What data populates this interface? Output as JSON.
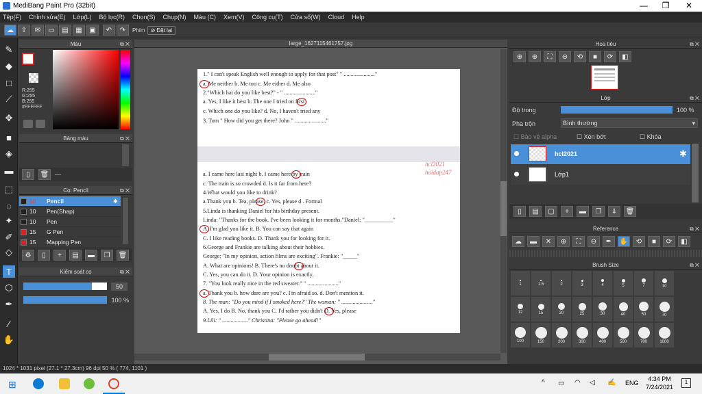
{
  "window": {
    "title": "MediBang Paint Pro (32bit)",
    "minimize": "—",
    "maximize": "❐",
    "close": "✕"
  },
  "menu": [
    "Tệp(F)",
    "Chỉnh sửa(E)",
    "Lớp(L)",
    "Bộ lọc(R)",
    "Chọn(S)",
    "Chụp(N)",
    "Màu (C)",
    "Xem(V)",
    "Công cụ(T)",
    "Cửa sổ(W)",
    "Cloud",
    "Help"
  ],
  "toolbar": {
    "phim_label": "Phím",
    "reset_label": "Đặt lại"
  },
  "canvas": {
    "tab_title": "large_1627115461757.jpg"
  },
  "color_panel": {
    "title": "Màu",
    "r": "R:255",
    "g": "G:255",
    "b": "B:255",
    "hex": "#FFFFFF"
  },
  "palette_panel": {
    "title": "Bảng màu",
    "dash": "---"
  },
  "brush_panel": {
    "title": "Cọ: Pencil",
    "items": [
      {
        "size": "50",
        "name": "Pencil",
        "color": "#222222",
        "selected": true
      },
      {
        "size": "10",
        "name": "Pen(Shap)",
        "color": "#222222",
        "selected": false
      },
      {
        "size": "10",
        "name": "Pen",
        "color": "#222222",
        "selected": false
      },
      {
        "size": "15",
        "name": "G Pen",
        "color": "#e02020",
        "selected": false
      },
      {
        "size": "15",
        "name": "Mapping Pen",
        "color": "#e02020",
        "selected": false
      }
    ]
  },
  "brush_control": {
    "title": "Kiểm soát cọ",
    "size": "50",
    "opacity": "100 %",
    "size_fraction": 0.82,
    "opacity_fraction": 1.0
  },
  "navigator": {
    "title": "Hoa tiêu"
  },
  "layer_panel": {
    "title": "Lớp",
    "opacity_label": "Độ trong",
    "opacity_value": "100 %",
    "blend_label": "Pha trộn",
    "blend_value": "Bình thường",
    "protect_alpha": "Bảo vệ alpha",
    "clipping": "Xén bớt",
    "lock": "Khóa",
    "layers": [
      {
        "name": "hcl2021",
        "selected": true
      },
      {
        "name": "Lớp1",
        "selected": false
      }
    ]
  },
  "reference_panel": {
    "title": "Reference"
  },
  "brush_size_panel": {
    "title": "Brush Size",
    "sizes": [
      "1",
      "1.5",
      "2",
      "3",
      "4",
      "5",
      "7",
      "10",
      "12",
      "15",
      "20",
      "25",
      "30",
      "40",
      "50",
      "70",
      "100",
      "150",
      "200",
      "300",
      "400",
      "500",
      "700",
      "1000"
    ]
  },
  "status": {
    "text": "1024 * 1031 pixel  (27.1 * 27.3cm)  96 dpi  50 %  ( 774, 1101 )"
  },
  "document": {
    "lines_top": [
      "1.\" I can't speak English well enough to apply for that post\" \" ......................\"",
      "a. Me neither          b. Me too          c. Me either        d. Me also",
      "2.\"Which hat do you like best?\" - \" ......................\"",
      "a. Yes, I like it best               b. The one I tried on first",
      "c. Which one do you like?        d. No, I haven't tried any",
      "3. Tom \" How did you get there?  John \" ......................\""
    ],
    "lines_bottom": [
      "a. I came here last night              b. I came here by train",
      "c. The train is so crowded           d. Is it far from here?",
      "4.What would you like to drink?",
      "a.Thank you       b. Tea, please.     c. Yes, please d   . Formal",
      "5.Linda is thanking Daniel for his birthday present.",
      "Linda: \"Thanks for the book. I've been looking it for months.\"Daniel: \"__________\"",
      "A. I'm glad you like it.              B. You can say that again",
      "C. I like reading books.            D. Thank you for looking for it.",
      "6.George and Frankie are talking about their hobbies.",
      "George: \"In my opinion, action films are exciting\". Frankie: \"_____\"",
      "A. What are opinions!              B. There's no doubt about it.",
      "C. Yes, you can do it.              D. Your opinion is exactly.",
      "7. \"You look really nice in the red sweater.\" \" ......................\"",
      "a. Thank you  b. how dare are you?           c. I'm afraid so.        d. Don't mention it.",
      "8. The man: \"Do you mind if I smoked here?\" The woman: \" ......................\"",
      "A. Yes, I do         B. No, thank you          C. I'd rather you didn't           D. Yes, please",
      "9.Lili: \" ..................\"          Christina: \"Please go ahead!\""
    ],
    "handwriting_1": "hcl2021",
    "handwriting_2": "hoidap247"
  },
  "taskbar": {
    "time": "4:34 PM",
    "date": "7/24/2021",
    "lang": "ENG",
    "tray_chevron": "^",
    "notif_count": "1"
  },
  "colors": {
    "accent": "#4a90d9",
    "panel": "#3a3a3a",
    "canvas_bg": "#595959"
  }
}
